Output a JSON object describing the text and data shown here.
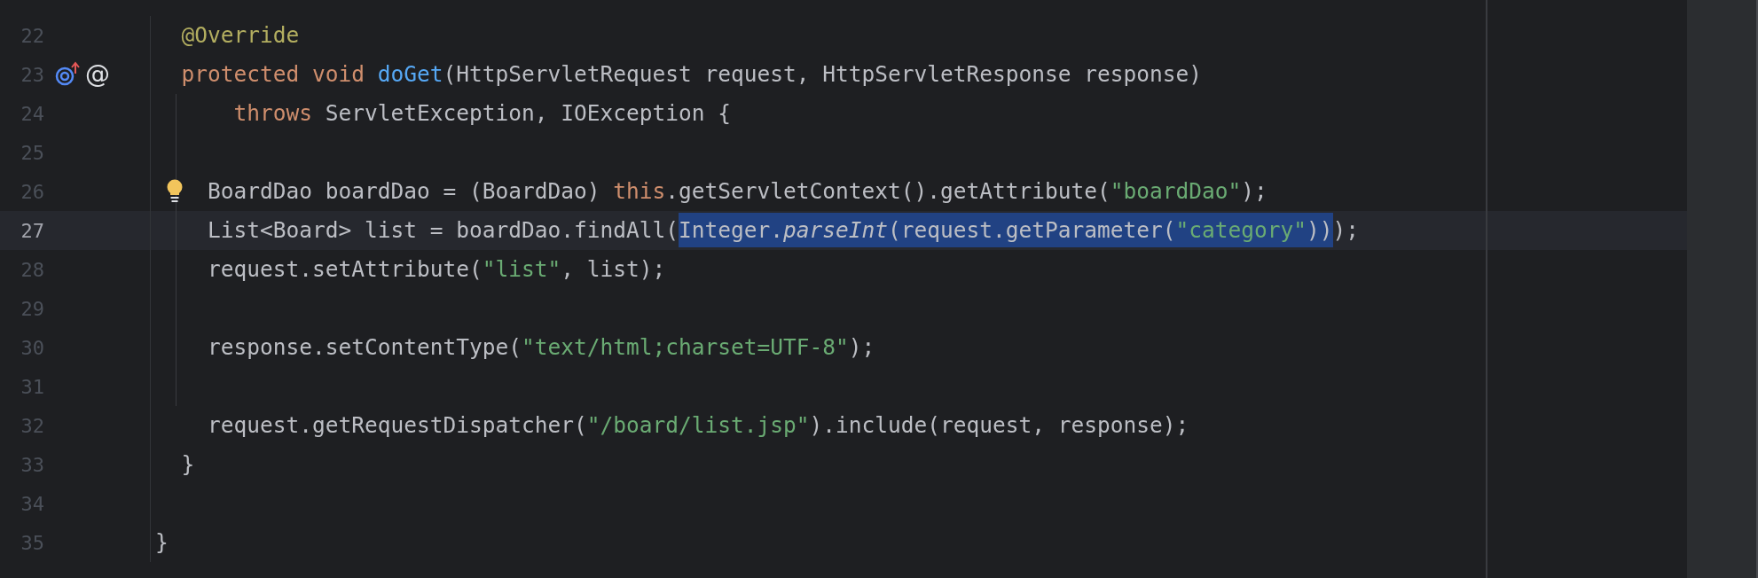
{
  "editor": {
    "lines": [
      {
        "number": "22",
        "current": false,
        "kind": "member",
        "tokens": [
          {
            "text": "@Override",
            "kind": "annotation"
          }
        ]
      },
      {
        "number": "23",
        "current": false,
        "kind": "member",
        "markers": [
          {
            "kind": "overrides"
          },
          {
            "kind": "glyph",
            "text": "@"
          }
        ],
        "tokens": [
          {
            "text": "protected void ",
            "kind": "keyword"
          },
          {
            "text": "doGet",
            "kind": "method"
          },
          {
            "text": "(HttpServletRequest request, HttpServletResponse response)",
            "kind": "plain"
          }
        ]
      },
      {
        "number": "24",
        "current": false,
        "kind": "continuation",
        "tokens": [
          {
            "text": "throws ",
            "kind": "keyword"
          },
          {
            "text": "ServletException, IOException {",
            "kind": "plain"
          }
        ]
      },
      {
        "number": "25",
        "current": false
      },
      {
        "number": "26",
        "current": false,
        "kind": "body",
        "bulb": true,
        "tokens": [
          {
            "text": "BoardDao boardDao = (BoardDao) ",
            "kind": "plain"
          },
          {
            "text": "this",
            "kind": "keyword"
          },
          {
            "text": ".getServletContext().getAttribute(",
            "kind": "plain"
          },
          {
            "text": "\"boardDao\"",
            "kind": "string"
          },
          {
            "text": ");",
            "kind": "plain"
          }
        ]
      },
      {
        "number": "27",
        "current": true,
        "kind": "body",
        "tokens": [
          {
            "text": "List<Board> list = boardDao.findAll(",
            "kind": "plain",
            "selected": false
          },
          {
            "text": "Integer.",
            "kind": "plain",
            "selected": true
          },
          {
            "text": "parseInt",
            "kind": "static",
            "selected": true
          },
          {
            "text": "(request.getParameter(",
            "kind": "plain",
            "selected": true
          },
          {
            "text": "\"category\"",
            "kind": "string",
            "selected": true
          },
          {
            "text": "))",
            "kind": "plain",
            "selected": true
          },
          {
            "text": ");",
            "kind": "plain",
            "selected": false
          }
        ]
      },
      {
        "number": "28",
        "current": false,
        "kind": "body",
        "tokens": [
          {
            "text": "request.setAttribute(",
            "kind": "plain"
          },
          {
            "text": "\"list\"",
            "kind": "string"
          },
          {
            "text": ", list);",
            "kind": "plain"
          }
        ]
      },
      {
        "number": "29",
        "current": false
      },
      {
        "number": "30",
        "current": false,
        "kind": "body",
        "tokens": [
          {
            "text": "response.setContentType(",
            "kind": "plain"
          },
          {
            "text": "\"text/html;charset=UTF-8\"",
            "kind": "string"
          },
          {
            "text": ");",
            "kind": "plain"
          }
        ]
      },
      {
        "number": "31",
        "current": false
      },
      {
        "number": "32",
        "current": false,
        "kind": "body",
        "tokens": [
          {
            "text": "request.getRequestDispatcher(",
            "kind": "plain"
          },
          {
            "text": "\"/board/list.jsp\"",
            "kind": "string"
          },
          {
            "text": ").include(request, response);",
            "kind": "plain"
          }
        ]
      },
      {
        "number": "33",
        "current": false,
        "kind": "member",
        "tokens": [
          {
            "text": "}",
            "kind": "plain"
          }
        ]
      },
      {
        "number": "34",
        "current": false
      },
      {
        "number": "35",
        "current": false,
        "kind": "top",
        "tokens": [
          {
            "text": "}",
            "kind": "plain"
          }
        ]
      }
    ]
  }
}
